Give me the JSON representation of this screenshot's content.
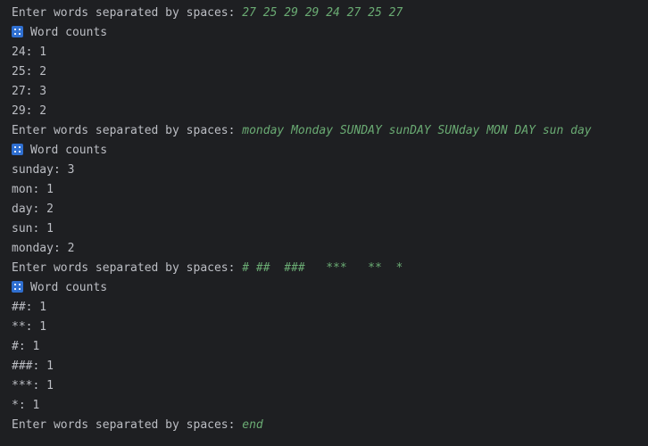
{
  "prompt_label": "Enter words separated by spaces: ",
  "heading_icon": "numbers-grid-icon",
  "colors": {
    "background": "#1e1f22",
    "text": "#bcbec4",
    "user_input": "#6aab73",
    "icon": "#2f6fd0"
  },
  "sessions": [
    {
      "input": "27 25 29 29 24 27 25 27",
      "heading": "Word counts",
      "counts": [
        "24: 1",
        "25: 2",
        "27: 3",
        "29: 2"
      ]
    },
    {
      "input": "monday Monday SUNDAY sunDAY SUNday MON DAY sun day",
      "heading": "Word counts",
      "counts": [
        "sunday: 3",
        "mon: 1",
        "day: 2",
        "sun: 1",
        "monday: 2"
      ]
    },
    {
      "input": "# ##  ###   ***   **  *",
      "heading": "Word counts",
      "counts": [
        "##: 1",
        "**: 1",
        "#: 1",
        "###: 1",
        "***: 1",
        "*: 1"
      ]
    }
  ],
  "final_input": "end"
}
